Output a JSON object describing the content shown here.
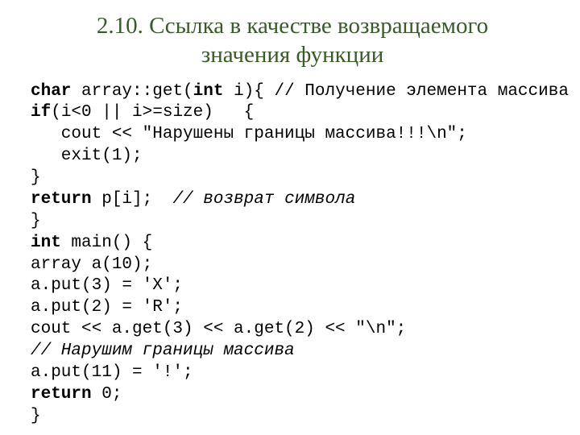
{
  "title_line1": "2.10. Ссылка в качестве возвращаемого",
  "title_line2": "значения функции",
  "code": {
    "l1a": "char",
    "l1b": " array::get(",
    "l1c": "int",
    "l1d": " i){ // Получение элемента массива",
    "l2a": "if",
    "l2b": "(i<0 || i>=size)   {",
    "l3": "   cout << \"Нарушены границы массива!!!\\n\";",
    "l4": "   exit(1);",
    "l5": "}",
    "l6a": "return",
    "l6b": " p[i];  ",
    "l6c": "// возврат символа",
    "l7": "}",
    "l8a": "int",
    "l8b": " main() {",
    "l9": "array a(10);",
    "l10": "a.put(3) = 'X';",
    "l11": "a.put(2) = 'R';",
    "l12": "cout << a.get(3) << a.get(2) << \"\\n\";",
    "l13": "// Нарушим границы массива",
    "l14": "a.put(11) = '!';",
    "l15a": "return",
    "l15b": " 0;",
    "l16": "}"
  }
}
